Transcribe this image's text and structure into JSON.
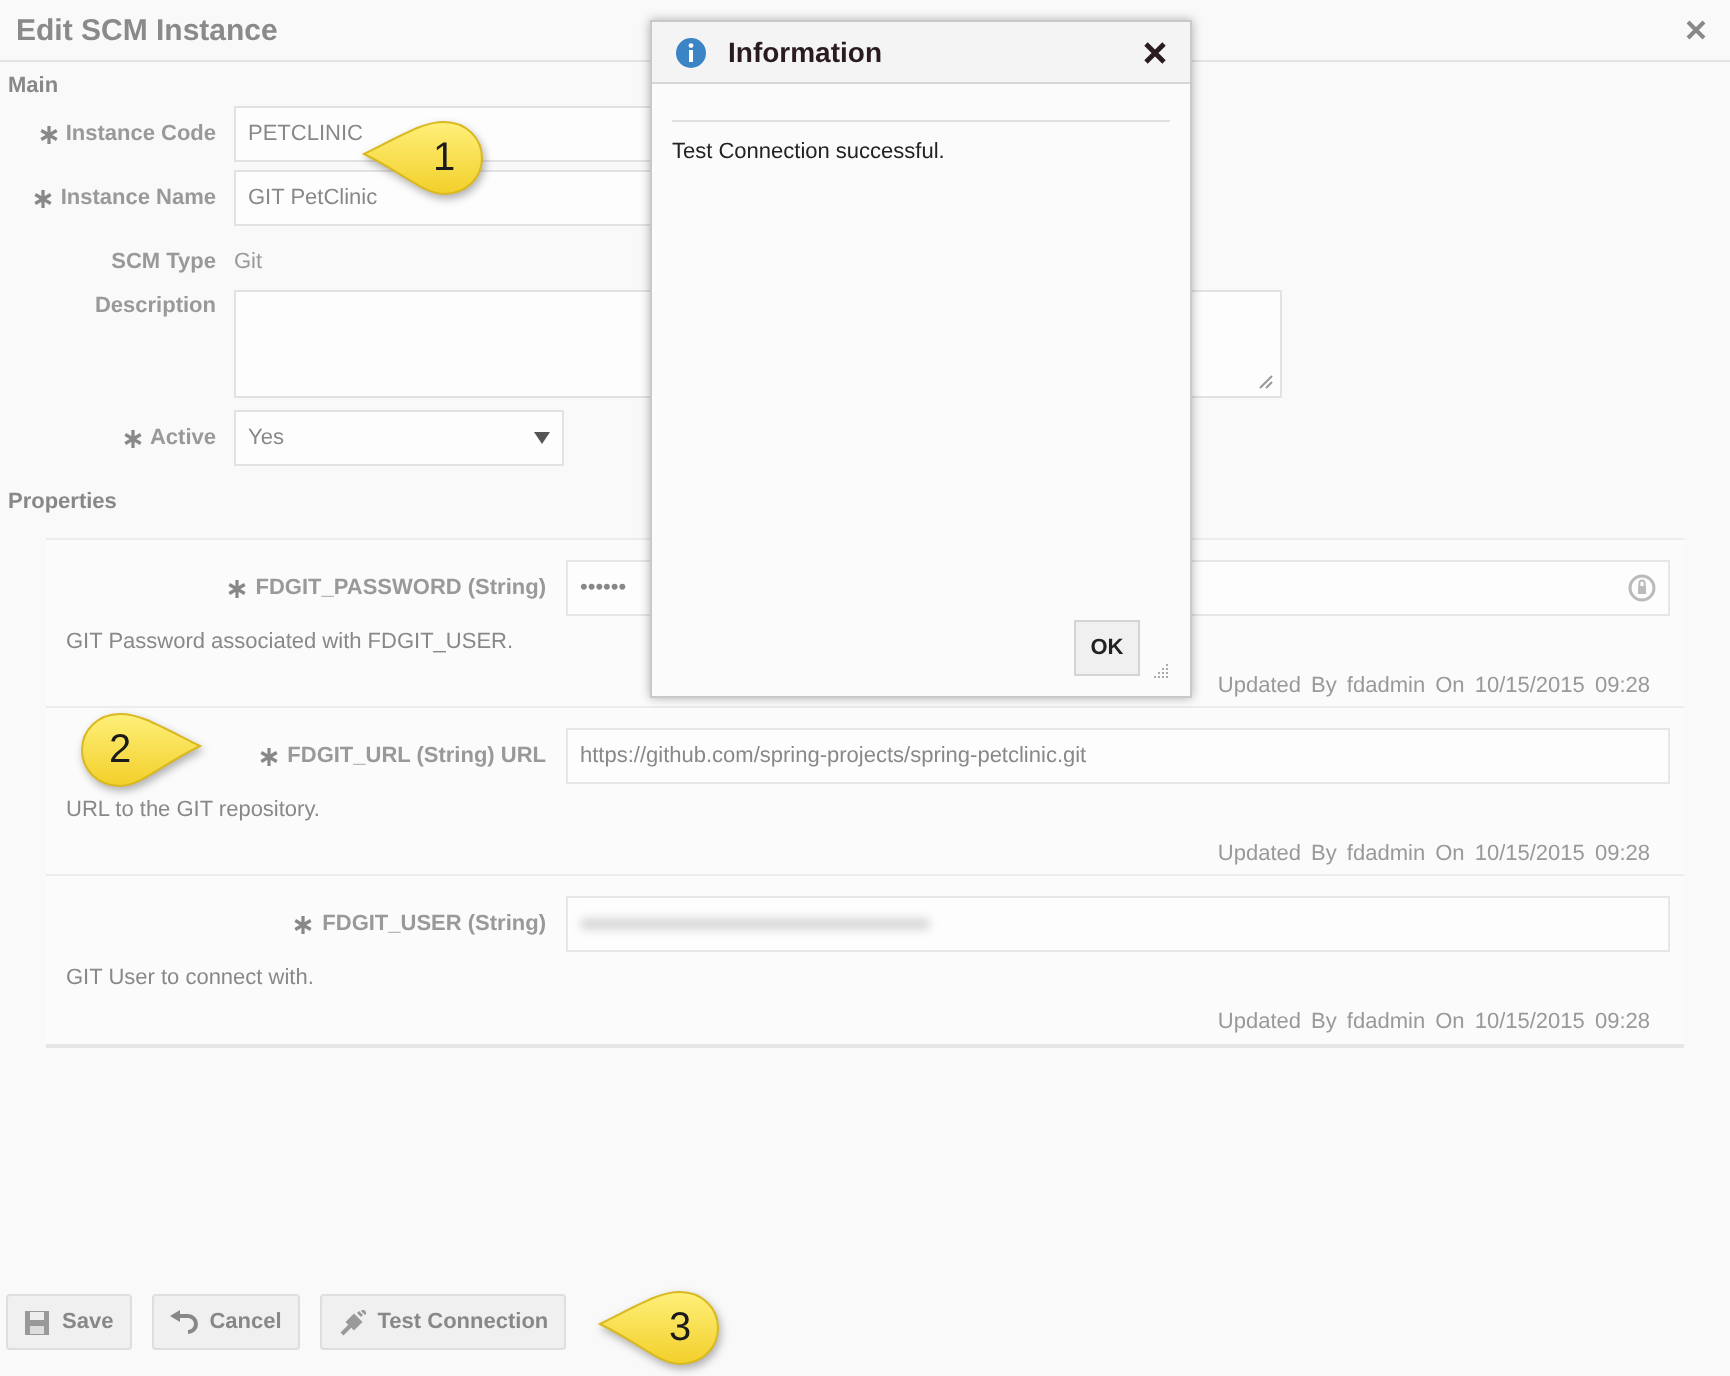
{
  "window": {
    "title": "Edit SCM Instance"
  },
  "main": {
    "heading": "Main",
    "fields": [
      {
        "kind": "input",
        "label": "Instance Code",
        "required": true,
        "value": "PETCLINIC"
      },
      {
        "kind": "input",
        "label": "Instance Name",
        "required": true,
        "value": "GIT PetClinic"
      },
      {
        "kind": "text",
        "label": "SCM Type",
        "required": false,
        "value": "Git"
      },
      {
        "kind": "textarea",
        "label": "Description",
        "required": false
      },
      {
        "kind": "select",
        "label": "Active",
        "required": true,
        "value": "Yes"
      }
    ]
  },
  "properties": {
    "heading": "Properties",
    "items": [
      {
        "kind": "password",
        "name": "FDGIT_PASSWORD (String)",
        "required": true,
        "value": "••••••",
        "description": "GIT Password associated with FDGIT_USER.",
        "updated": "Updated By fdadmin On 10/15/2015 09:28"
      },
      {
        "kind": "input",
        "name": "FDGIT_URL (String) URL",
        "required": true,
        "value": "https://github.com/spring-projects/spring-petclinic.git",
        "description": "URL to the GIT repository.",
        "updated": "Updated By fdadmin On 10/15/2015 09:28"
      },
      {
        "kind": "blurred",
        "name": "FDGIT_USER (String)",
        "required": true,
        "description": "GIT User to connect with.",
        "updated": "Updated By fdadmin On 10/15/2015 09:28"
      }
    ]
  },
  "buttons": [
    {
      "kind": "save",
      "label": "Save"
    },
    {
      "kind": "undo",
      "label": "Cancel"
    },
    {
      "kind": "plug",
      "label": "Test Connection"
    }
  ],
  "dialog": {
    "title": "Information",
    "message": "Test Connection successful.",
    "ok": "OK"
  },
  "callouts": [
    {
      "number": "1"
    },
    {
      "number": "2"
    },
    {
      "number": "3"
    }
  ]
}
